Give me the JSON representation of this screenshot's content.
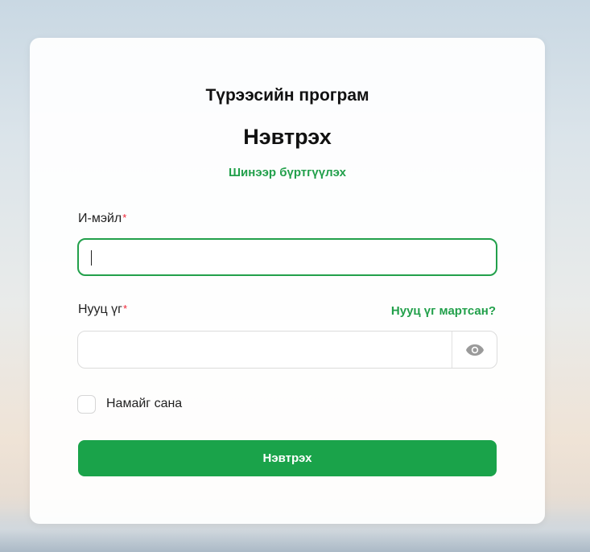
{
  "app_title": "Түрээсийн програм",
  "login": {
    "heading": "Нэвтрэх",
    "register_link": "Шинээр бүртгүүлэх",
    "email": {
      "label": "И-мэйл",
      "required_mark": "*",
      "value": "",
      "placeholder": ""
    },
    "password": {
      "label": "Нууц үг",
      "required_mark": "*",
      "value": "",
      "placeholder": "",
      "forgot_link": "Нууц үг мартсан?",
      "toggle_icon": "eye-icon"
    },
    "remember": {
      "label": "Намайг сана",
      "checked": false
    },
    "submit_label": "Нэвтрэх"
  },
  "colors": {
    "accent": "#1aa34a",
    "required": "#e23333"
  }
}
